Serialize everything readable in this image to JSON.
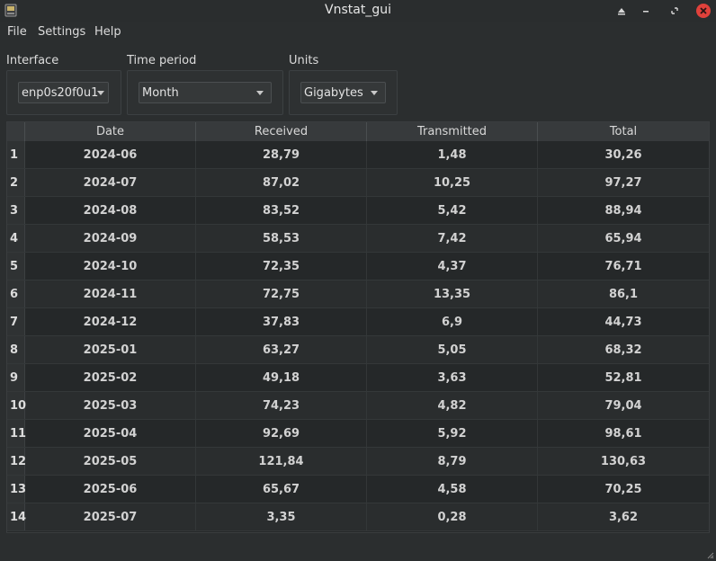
{
  "window": {
    "title": "Vnstat_gui",
    "close_color": "#e0413b"
  },
  "menu": [
    "File",
    "Settings",
    "Help"
  ],
  "controls": {
    "interface": {
      "label": "Interface",
      "value": "enp0s20f0u1"
    },
    "time_period": {
      "label": "Time period",
      "value": "Month"
    },
    "units": {
      "label": "Units",
      "value": "Gigabytes"
    }
  },
  "table": {
    "headers": [
      "Date",
      "Received",
      "Transmitted",
      "Total"
    ],
    "rows": [
      {
        "n": "1",
        "date": "2024-06",
        "received": "28,79",
        "transmitted": "1,48",
        "total": "30,26"
      },
      {
        "n": "2",
        "date": "2024-07",
        "received": "87,02",
        "transmitted": "10,25",
        "total": "97,27"
      },
      {
        "n": "3",
        "date": "2024-08",
        "received": "83,52",
        "transmitted": "5,42",
        "total": "88,94"
      },
      {
        "n": "4",
        "date": "2024-09",
        "received": "58,53",
        "transmitted": "7,42",
        "total": "65,94"
      },
      {
        "n": "5",
        "date": "2024-10",
        "received": "72,35",
        "transmitted": "4,37",
        "total": "76,71"
      },
      {
        "n": "6",
        "date": "2024-11",
        "received": "72,75",
        "transmitted": "13,35",
        "total": "86,1"
      },
      {
        "n": "7",
        "date": "2024-12",
        "received": "37,83",
        "transmitted": "6,9",
        "total": "44,73"
      },
      {
        "n": "8",
        "date": "2025-01",
        "received": "63,27",
        "transmitted": "5,05",
        "total": "68,32"
      },
      {
        "n": "9",
        "date": "2025-02",
        "received": "49,18",
        "transmitted": "3,63",
        "total": "52,81"
      },
      {
        "n": "10",
        "date": "2025-03",
        "received": "74,23",
        "transmitted": "4,82",
        "total": "79,04"
      },
      {
        "n": "11",
        "date": "2025-04",
        "received": "92,69",
        "transmitted": "5,92",
        "total": "98,61"
      },
      {
        "n": "12",
        "date": "2025-05",
        "received": "121,84",
        "transmitted": "8,79",
        "total": "130,63"
      },
      {
        "n": "13",
        "date": "2025-06",
        "received": "65,67",
        "transmitted": "4,58",
        "total": "70,25"
      },
      {
        "n": "14",
        "date": "2025-07",
        "received": "3,35",
        "transmitted": "0,28",
        "total": "3,62"
      }
    ]
  }
}
